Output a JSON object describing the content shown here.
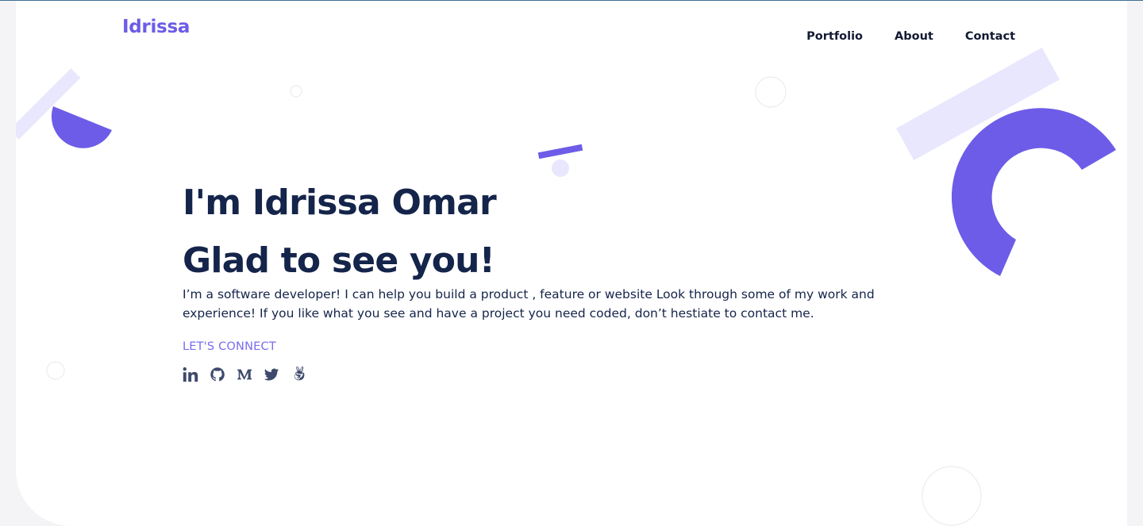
{
  "header": {
    "logo": "Idrissa",
    "nav": [
      {
        "label": "Portfolio"
      },
      {
        "label": "About"
      },
      {
        "label": "Contact"
      }
    ]
  },
  "hero": {
    "title_line1": "I'm Idrissa Omar",
    "title_line2": "Glad to see you!",
    "intro": "I’m a software developer! I can help you build a product , feature or website Look through some of my work and experience! If you like what you see and have a project you need coded, don’t hestiate to contact me.",
    "connect_label": "LET'S CONNECT",
    "socials": [
      {
        "icon": "linkedin-icon"
      },
      {
        "icon": "github-icon"
      },
      {
        "icon": "medium-icon"
      },
      {
        "icon": "twitter-icon"
      },
      {
        "icon": "angellist-icon"
      }
    ]
  },
  "colors": {
    "accent": "#6c5ce7",
    "accent_light": "#e9e7fd",
    "heading": "#14244a",
    "background": "#f4f4f6"
  }
}
